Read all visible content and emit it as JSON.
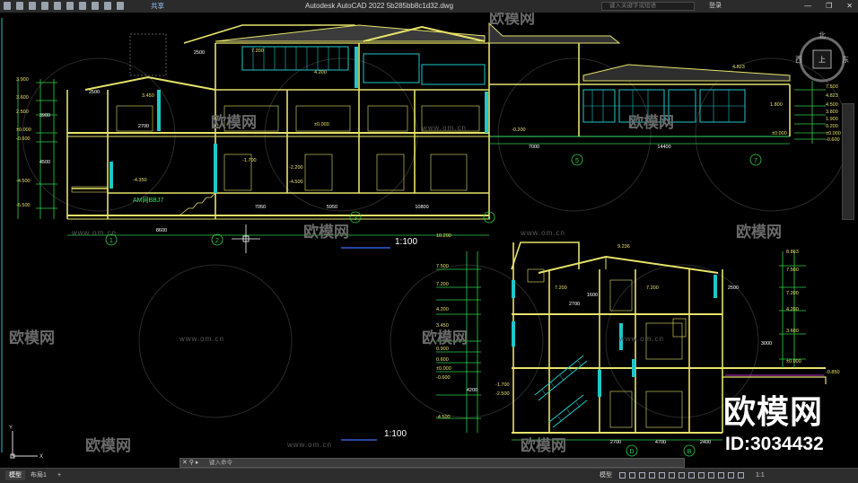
{
  "app": {
    "title": "Autodesk AutoCAD 2022    5b285bb8c1d32.dwg",
    "share_label": "共享",
    "search_placeholder": "键入关键字或短语",
    "login_label": "登录"
  },
  "drawing": {
    "scale_label_1": "1:100",
    "scale_label_2": "1:100",
    "room_label": "AM网BBJ7",
    "section1": {
      "elevations_left": [
        "3.900",
        "3.600",
        "2.500",
        "±0.000",
        "-0.600",
        "-4.500",
        "-6.500"
      ],
      "elevations_top": [
        "7.200",
        "4.200",
        "3.450",
        "±0.000",
        "-1.700",
        "-2.200",
        "-4.350",
        "-4.500",
        "-0.200",
        "4.823",
        "1.800",
        "±0.000"
      ],
      "elevations_right": [
        "7.500",
        "4.823",
        "4.500",
        "3.800",
        "1.900",
        "0.200",
        "±0.000",
        "-0.600"
      ],
      "dims_bottom": [
        "8600",
        "7050",
        "5950",
        "10800",
        "7000",
        "14400"
      ],
      "axes": [
        "1",
        "2",
        "3",
        "4",
        "5",
        "7"
      ],
      "dims_misc": [
        "2500",
        "2500",
        "2700",
        "3900",
        "4500"
      ]
    },
    "section2": {
      "elevations_left": [
        "10.200",
        "7.500",
        "7.200",
        "4.200",
        "3.450",
        "0.900",
        "0.600",
        "±0.000",
        "-0.600",
        "-1.700",
        "-2.500",
        "-4.500"
      ],
      "elevations_right": [
        "8.863",
        "7.500",
        "7.200",
        "4.200",
        "3.600",
        "±0.000",
        "-0.850"
      ],
      "elevations_top": [
        "9.236",
        "7.200",
        "7.200"
      ],
      "dims_bottom": [
        "2700",
        "4700",
        "2400"
      ],
      "axes": [
        "D",
        "B"
      ],
      "dims_misc": [
        "2500",
        "1600",
        "2700",
        "4200",
        "3000"
      ]
    },
    "watermark_site": "www.om.cn",
    "watermark_brand": "欧模网"
  },
  "viewcube": {
    "north": "北",
    "west": "西",
    "east": "东",
    "top": "上"
  },
  "command": {
    "placeholder": "键入命令"
  },
  "status": {
    "tab_model": "模型",
    "tab_layout": "布局1",
    "model_label": "模型",
    "scale": "1:1"
  },
  "watermark": {
    "brand_big": "欧模网",
    "id_label": "ID:3034432"
  },
  "colors": {
    "line_yellow": "#e6e26a",
    "line_green": "#36e26c",
    "window_cyan": "#1ec8c8",
    "dim_green": "#2bd24a",
    "text_white": "#ffffff"
  }
}
